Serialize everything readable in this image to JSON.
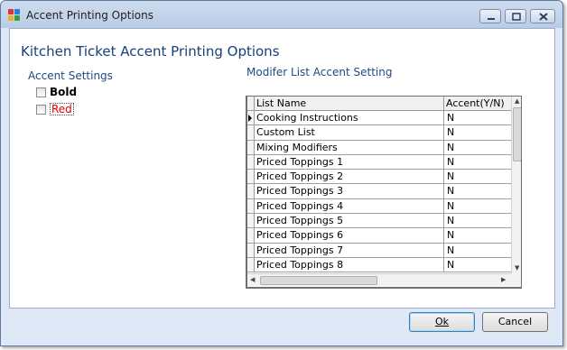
{
  "window": {
    "title": "Accent Printing Options"
  },
  "heading": "Kitchen Ticket Accent Printing Options",
  "accent_settings": {
    "label": "Accent Settings",
    "bold": {
      "label": "Bold",
      "checked": false
    },
    "red": {
      "label": "Red",
      "checked": false,
      "color": "#e00000"
    }
  },
  "modifier_list": {
    "label": "Modifer List Accent Setting",
    "columns": [
      "List Name",
      "Accent(Y/N)"
    ],
    "rows": [
      {
        "name": "Cooking Instructions",
        "accent": "N"
      },
      {
        "name": "Custom List",
        "accent": "N"
      },
      {
        "name": "Mixing Modifiers",
        "accent": "N"
      },
      {
        "name": "Priced Toppings 1",
        "accent": "N"
      },
      {
        "name": "Priced Toppings 2",
        "accent": "N"
      },
      {
        "name": "Priced Toppings 3",
        "accent": "N"
      },
      {
        "name": "Priced Toppings 4",
        "accent": "N"
      },
      {
        "name": "Priced Toppings 5",
        "accent": "N"
      },
      {
        "name": "Priced Toppings 6",
        "accent": "N"
      },
      {
        "name": "Priced Toppings 7",
        "accent": "N"
      },
      {
        "name": "Priced Toppings 8",
        "accent": "N"
      }
    ]
  },
  "buttons": {
    "ok": "Ok",
    "cancel": "Cancel"
  },
  "colors": {
    "heading": "#16407a",
    "group_label": "#1c4a86",
    "window_bg": "#dfe8f6"
  }
}
